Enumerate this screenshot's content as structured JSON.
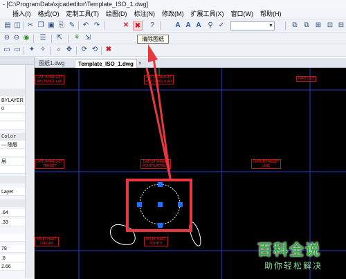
{
  "app": {
    "title": "- [C:\\ProgramData\\xjcadeditor\\Template_ISO_1.dwg]"
  },
  "menu": [
    "插入(I)",
    "格式(O)",
    "定制工具(T)",
    "绘图(D)",
    "标注(N)",
    "修改(M)",
    "扩展工具(X)",
    "窗口(W)",
    "帮助(H)"
  ],
  "tooltip": "清除图纸",
  "tabs": [
    "图纸1.dwg",
    "Template_ISO_1.dwg",
    "×"
  ],
  "props": {
    "rows": [
      "BYLAYER",
      "0",
      "Color",
      "— 随层",
      "层",
      "Layer",
      ".64",
      ".33",
      "78",
      ".8",
      "2.66"
    ],
    "group_1": "ByLayer"
  },
  "canvas_labels": [
    "DATUMTARGET\nRECTANGULAR",
    "DATUMTARGET\nRECTANGULAR",
    "PARTLIST",
    "DATUMTARGET\nTARGET",
    "DATUMTARGET\nPOINT&ATTACH",
    "DATUMTARGET\nLINE",
    "MILECHART\nORIGIN",
    "MILECHART\nPOINTS"
  ],
  "watermark": {
    "logo": "百科全说",
    "sub": "助你轻松解决"
  },
  "colors": {
    "canvas": "#000000",
    "grid": "#2b3cd6",
    "highlight": "#e8383d",
    "watermark": "#2fae3e"
  }
}
